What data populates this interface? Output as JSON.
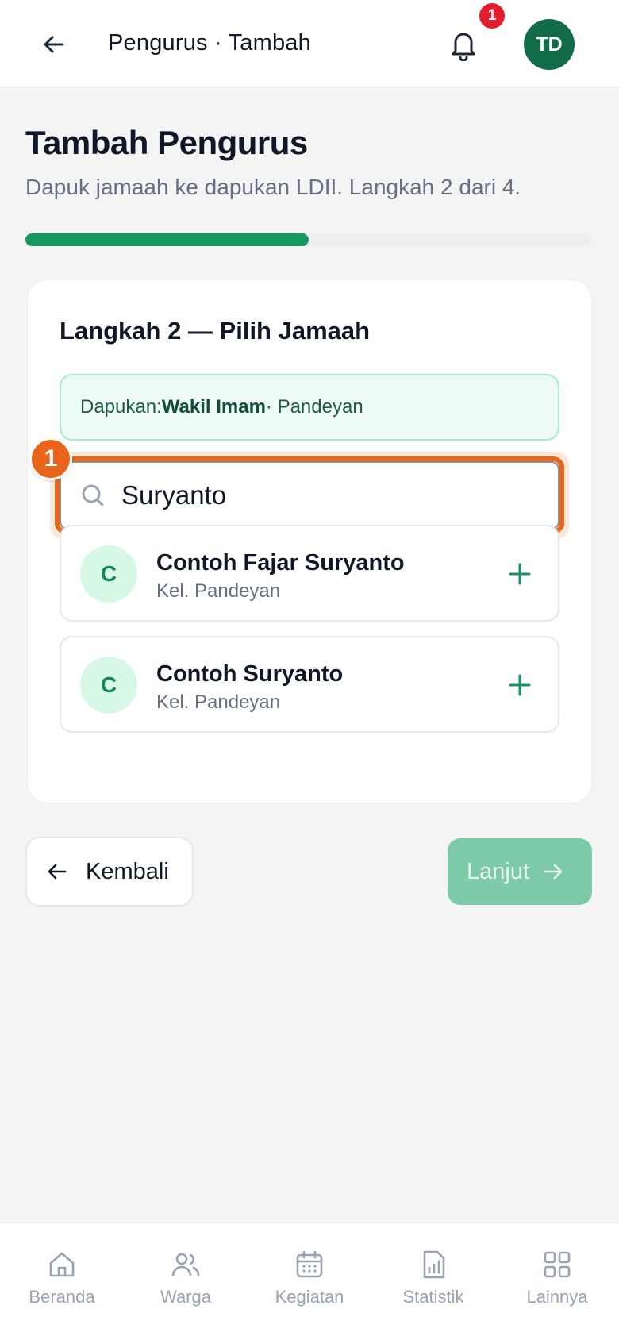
{
  "header": {
    "title": "Pengurus · Tambah",
    "notification_count": "1",
    "avatar_initials": "TD"
  },
  "page": {
    "title": "Tambah Pengurus",
    "subtitle": "Dapuk jamaah ke dapukan LDII. Langkah 2 dari 4.",
    "progress": {
      "current_step": 2,
      "total_steps": 4
    }
  },
  "card": {
    "title": "Langkah 2 — Pilih Jamaah",
    "info": {
      "prefix": "Dapukan: ",
      "role": "Wakil Imam",
      "location": " · Pandeyan"
    },
    "search": {
      "value": "Suryanto",
      "marker": "1"
    },
    "results": [
      {
        "initial": "C",
        "name": "Contoh Fajar Suryanto",
        "location": "Kel. Pandeyan"
      },
      {
        "initial": "C",
        "name": "Contoh Suryanto",
        "location": "Kel. Pandeyan"
      }
    ]
  },
  "actions": {
    "back_label": "Kembali",
    "next_label": "Lanjut"
  },
  "bottom_nav": {
    "items": [
      {
        "label": "Beranda",
        "icon": "home-icon"
      },
      {
        "label": "Warga",
        "icon": "users-icon"
      },
      {
        "label": "Kegiatan",
        "icon": "calendar-icon"
      },
      {
        "label": "Statistik",
        "icon": "stats-icon"
      },
      {
        "label": "Lainnya",
        "icon": "grid-icon"
      }
    ]
  },
  "colors": {
    "primary": "#16975f",
    "highlight": "#e8651b",
    "badge": "#e11d2e",
    "avatar_bg": "#116b49",
    "next_disabled": "#7ccaa8"
  }
}
